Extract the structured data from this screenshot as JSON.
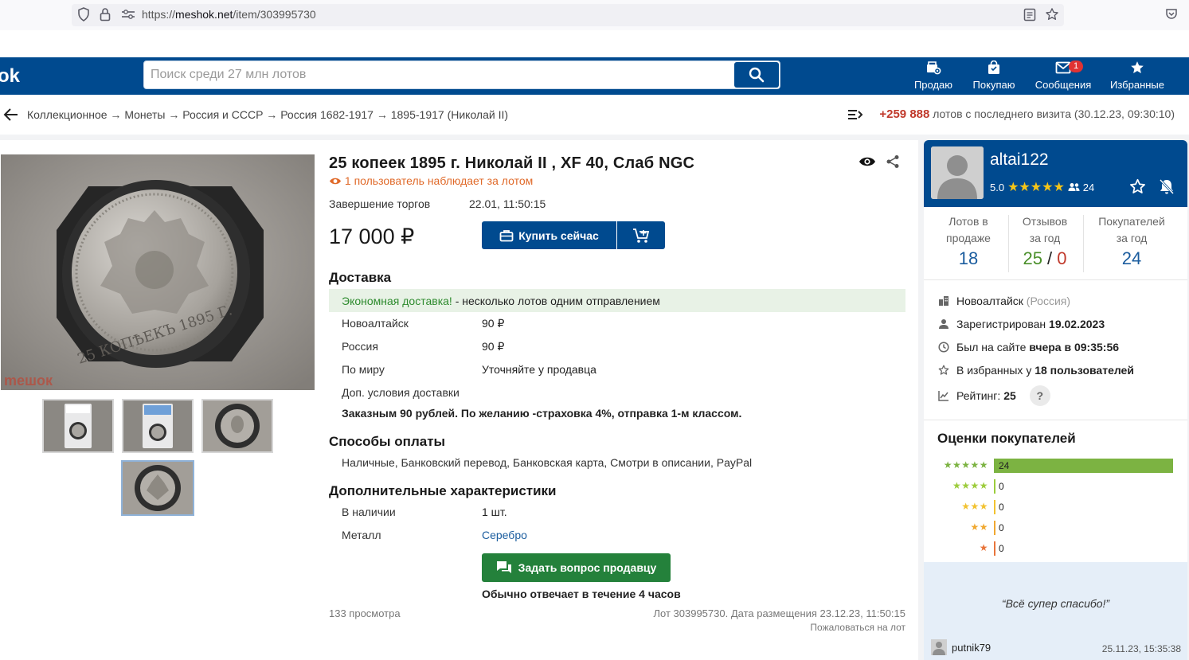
{
  "browser": {
    "url_prefix": "https://",
    "url_host": "meshok.net",
    "url_path": "/item/303995730"
  },
  "header": {
    "logo": "ok",
    "search_placeholder": "Поиск среди 27 млн лотов",
    "nav": {
      "sell": "Продаю",
      "buy": "Покупаю",
      "messages": "Сообщения",
      "messages_badge": "1",
      "favorites": "Избранные"
    }
  },
  "breadcrumb": {
    "path": "Коллекционное → Монеты → Россия и СССР → Россия 1682-1917 → 1895-1917 (Николай II)"
  },
  "visits": {
    "count": "+259 888",
    "text": "лотов с последнего визита (30.12.23, 09:30:10)"
  },
  "lot": {
    "title": "25 копеек 1895 г. Николай II , XF 40, Слаб NGC",
    "watchers": "1 пользователь наблюдает за лотом",
    "end_label": "Завершение торгов",
    "end_value": "22.01, 11:50:15",
    "price": "17 000 ₽",
    "buy_now": "Купить сейчас",
    "photo_watermark": "meшок"
  },
  "delivery": {
    "heading": "Доставка",
    "eco_green": "Экономная доставка!",
    "eco_rest": " - несколько лотов одним отправлением",
    "rows": [
      {
        "label": "Новоалтайск",
        "value": "90 ₽"
      },
      {
        "label": "Россия",
        "value": "90 ₽"
      },
      {
        "label": "По миру",
        "value": "Уточняйте у продавца"
      }
    ],
    "extra_label": "Доп. условия доставки",
    "extra_text": "Заказным 90 рублей. По желанию -страховка 4%, отправка 1-м классом."
  },
  "payment": {
    "heading": "Способы оплаты",
    "methods": "Наличные, Банковский перевод, Банковская карта, Смотри в описании, PayPal"
  },
  "characteristics": {
    "heading": "Дополнительные характеристики",
    "stock_label": "В наличии",
    "stock_value": "1 шт.",
    "metal_label": "Металл",
    "metal_value": "Серебро"
  },
  "ask": {
    "button": "Задать вопрос продавцу",
    "note": "Обычно отвечает в течение 4 часов"
  },
  "footer": {
    "views": "133 просмотра",
    "lot_info": "Лот 303995730. Дата размещения 23.12.23, 11:50:15",
    "report": "Пожаловаться на лот"
  },
  "seller": {
    "name": "altai122",
    "rating": "5.0",
    "stars": "★★★★★",
    "followers": "24",
    "stats": {
      "lots_label_1": "Лотов в",
      "lots_label_2": "продаже",
      "lots_value": "18",
      "reviews_label_1": "Отзывов",
      "reviews_label_2": "за год",
      "reviews_pos": "25",
      "reviews_sep": " / ",
      "reviews_neg": "0",
      "buyers_label_1": "Покупателей",
      "buyers_label_2": "за год",
      "buyers_value": "24"
    },
    "city": "Новоалтайск",
    "country": "(Россия)",
    "registered_label": "Зарегистрирован ",
    "registered_date": "19.02.2023",
    "online_label": "Был на сайте ",
    "online_value": "вчера в 09:35:56",
    "fav_label": "В избранных у ",
    "fav_value": "18 пользователей",
    "rating_label": "Рейтинг: ",
    "rating_value": "25",
    "help": "?"
  },
  "buyer_ratings": {
    "title": "Оценки покупателей",
    "rows": [
      {
        "stars": "★★★★★",
        "count": "24",
        "fraction": 1.0,
        "color": "#7cb342"
      },
      {
        "stars": "★★★★",
        "count": "0",
        "fraction": 0,
        "color": "#9ccc3b"
      },
      {
        "stars": "★★★",
        "count": "0",
        "fraction": 0,
        "color": "#f2c230"
      },
      {
        "stars": "★★",
        "count": "0",
        "fraction": 0,
        "color": "#f0a830"
      },
      {
        "stars": "★",
        "count": "0",
        "fraction": 0,
        "color": "#e8743a"
      }
    ]
  },
  "review": {
    "quote": "“Всё супер спасибо!”",
    "author": "putnik79",
    "date": "25.11.23, 15:35:38"
  },
  "colors": {
    "brand": "#004a8f",
    "green_button": "#24813b",
    "accent_red": "#c0392b"
  }
}
